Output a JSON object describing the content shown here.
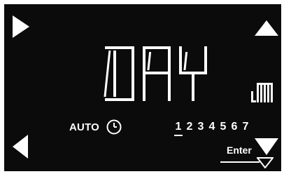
{
  "display": {
    "mode_text": "DAY",
    "auto_label": "AUTO",
    "enter_label": "Enter",
    "days": [
      "1",
      "2",
      "3",
      "4",
      "5",
      "6",
      "7"
    ],
    "active_day": "1"
  },
  "icons": {
    "right": "triangle-right-icon",
    "left": "triangle-left-icon",
    "up": "triangle-up-icon",
    "down": "triangle-down-icon",
    "clock": "clock-icon",
    "radiator": "radiator-icon"
  },
  "colors": {
    "screen": "#0b0b0b",
    "segments": "#ffffff"
  }
}
